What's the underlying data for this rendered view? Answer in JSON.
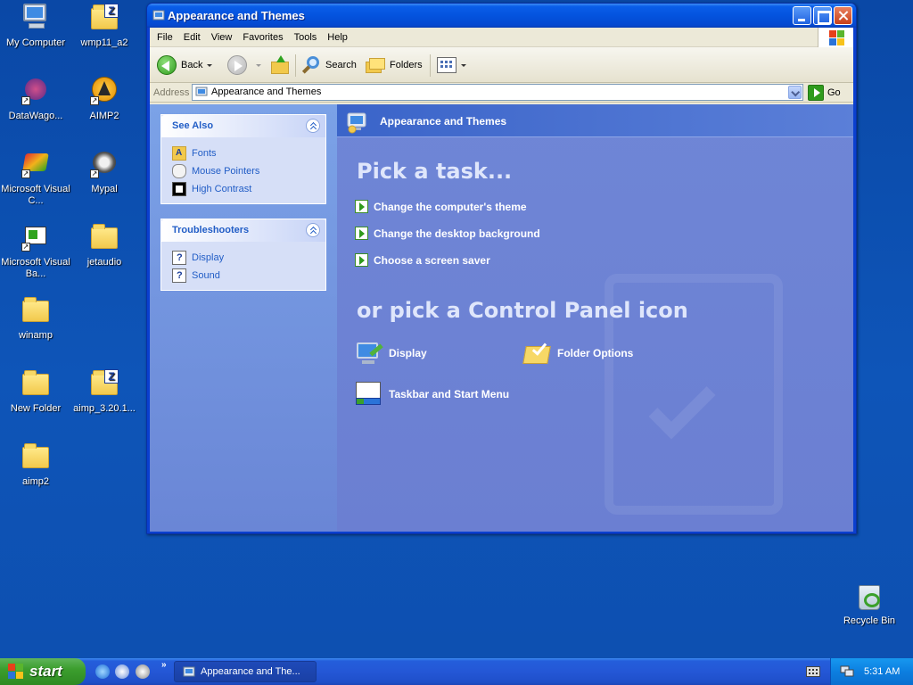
{
  "desktop": {
    "icons": [
      {
        "label": "My Computer"
      },
      {
        "label": "wmp11_a2"
      },
      {
        "label": "DataWago..."
      },
      {
        "label": "AIMP2"
      },
      {
        "label": "Microsoft Visual C..."
      },
      {
        "label": "Mypal"
      },
      {
        "label": "Microsoft Visual Ba..."
      },
      {
        "label": "jetaudio"
      },
      {
        "label": "winamp"
      },
      {
        "label": "New Folder"
      },
      {
        "label": "aimp_3.20.1..."
      },
      {
        "label": "aimp2"
      }
    ],
    "recycle_bin": "Recycle Bin"
  },
  "window": {
    "title": "Appearance and Themes",
    "menu": [
      "File",
      "Edit",
      "View",
      "Favorites",
      "Tools",
      "Help"
    ],
    "toolbar": {
      "back": "Back",
      "search": "Search",
      "folders": "Folders"
    },
    "address": {
      "label": "Address",
      "value": "Appearance and Themes",
      "go": "Go"
    },
    "see_also": {
      "title": "See Also",
      "items": [
        "Fonts",
        "Mouse Pointers",
        "High Contrast"
      ]
    },
    "troubleshooters": {
      "title": "Troubleshooters",
      "items": [
        "Display",
        "Sound"
      ]
    },
    "main": {
      "header": "Appearance and Themes",
      "pick_task": "Pick a task...",
      "tasks": [
        "Change the computer's theme",
        "Change the desktop background",
        "Choose a screen saver"
      ],
      "pick_icon": "or pick a Control Panel icon",
      "icons": [
        "Display",
        "Folder Options",
        "Taskbar and Start Menu"
      ]
    }
  },
  "taskbar": {
    "start": "start",
    "more": "»",
    "task_item": "Appearance and The...",
    "clock": "5:31 AM"
  }
}
